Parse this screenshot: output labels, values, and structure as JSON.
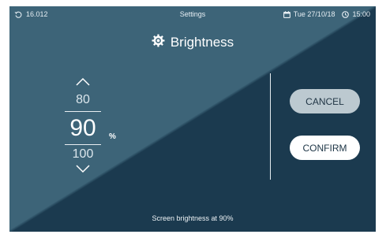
{
  "status_bar": {
    "left_value": "16.012",
    "center_title": "Settings",
    "date": "Tue 27/10/18",
    "time": "15:00",
    "icons": [
      "refresh-icon",
      "calendar-icon",
      "clock-icon"
    ]
  },
  "title": {
    "icon": "brightness-icon",
    "text": "Brightness"
  },
  "picker": {
    "prev_value": "80",
    "current_value": "90",
    "next_value": "100",
    "unit": "%",
    "up_icon": "chevron-up-icon",
    "down_icon": "chevron-down-icon"
  },
  "buttons": {
    "cancel": "CANCEL",
    "confirm": "CONFIRM"
  },
  "footer": {
    "message": "Screen brightness at 90%"
  },
  "colors": {
    "background_light": "#3d6478",
    "background_dark": "#1b3a4f",
    "cancel_button": "#bcc9d0",
    "confirm_button": "#ffffff"
  }
}
